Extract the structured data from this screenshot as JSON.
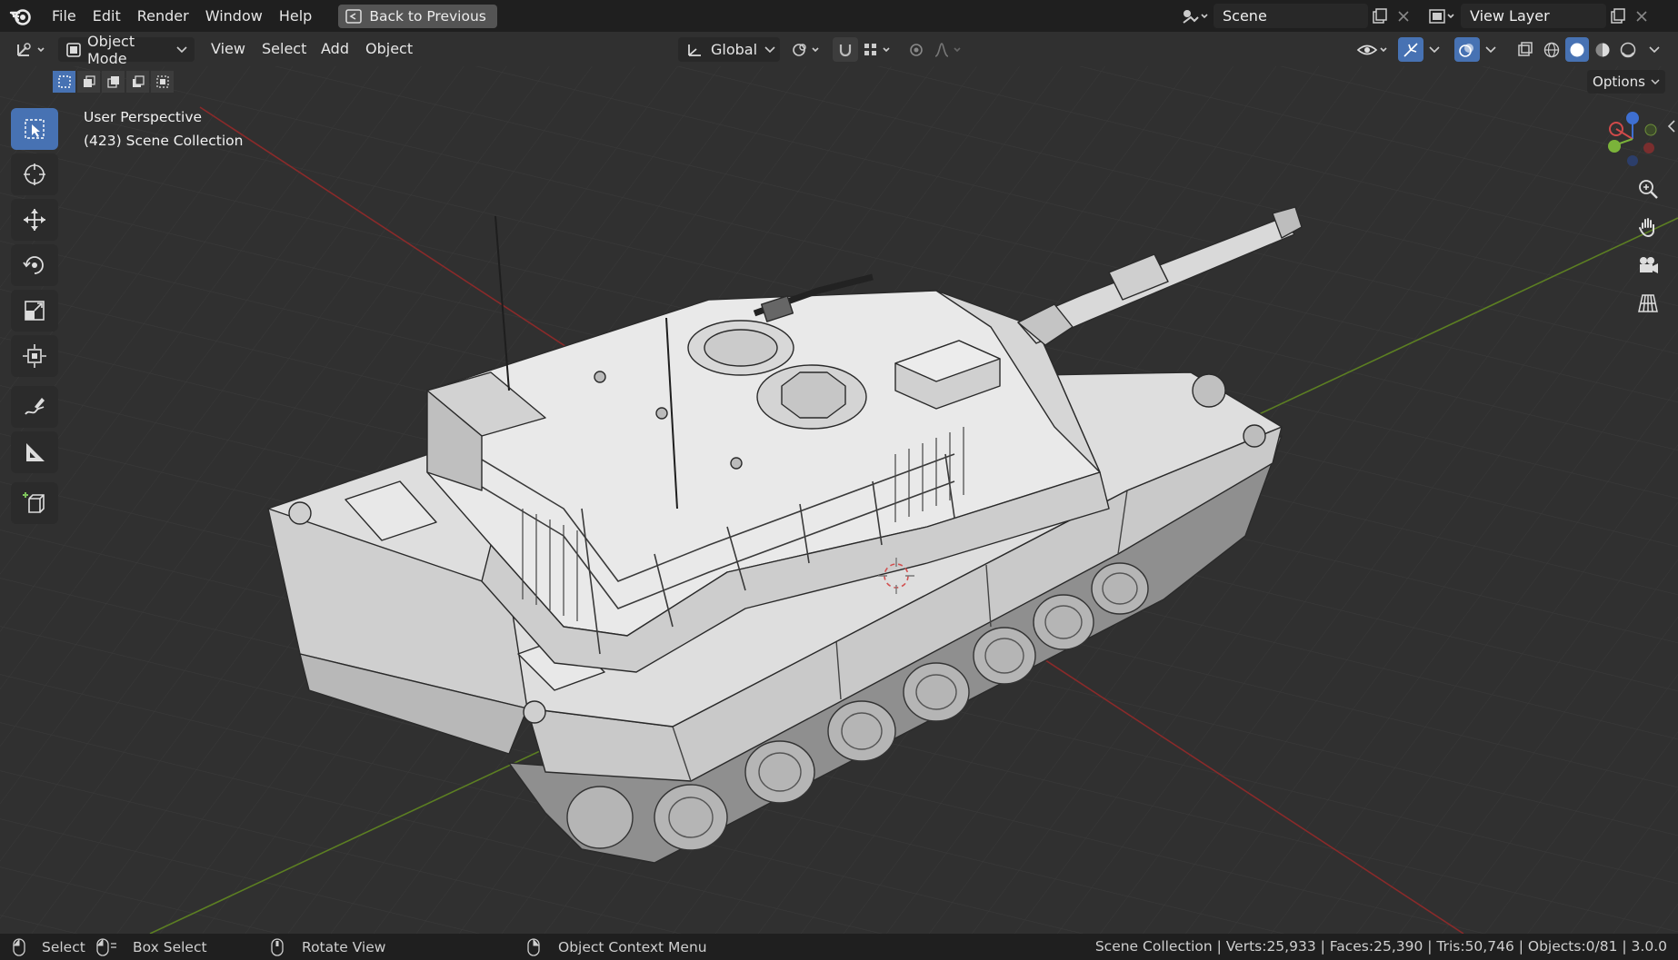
{
  "menubar": {
    "items": [
      "File",
      "Edit",
      "Render",
      "Window",
      "Help"
    ],
    "back_button": "Back to Previous",
    "scene": "Scene",
    "view_layer": "View Layer"
  },
  "header": {
    "mode": "Object Mode",
    "menus": [
      "View",
      "Select",
      "Add",
      "Object"
    ],
    "transform_orientation": "Global",
    "options_label": "Options"
  },
  "viewport": {
    "perspective": "User Perspective",
    "collection": "(423) Scene Collection"
  },
  "toolbar": {
    "tools": [
      "select-box",
      "cursor",
      "move",
      "rotate",
      "scale",
      "transform",
      "annotate",
      "measure",
      "add-cube"
    ],
    "active": "select-box"
  },
  "statusbar": {
    "hints": [
      "Select",
      "Box Select",
      "Rotate View",
      "Object Context Menu"
    ],
    "stats": "Scene Collection | Verts:25,933 | Faces:25,390 | Tris:50,746 | Objects:0/81 | 3.0.0"
  },
  "colors": {
    "accent": "#4772b3",
    "background": "#303030",
    "x_axis": "#8a2a2a",
    "y_axis": "#5c7f22"
  }
}
